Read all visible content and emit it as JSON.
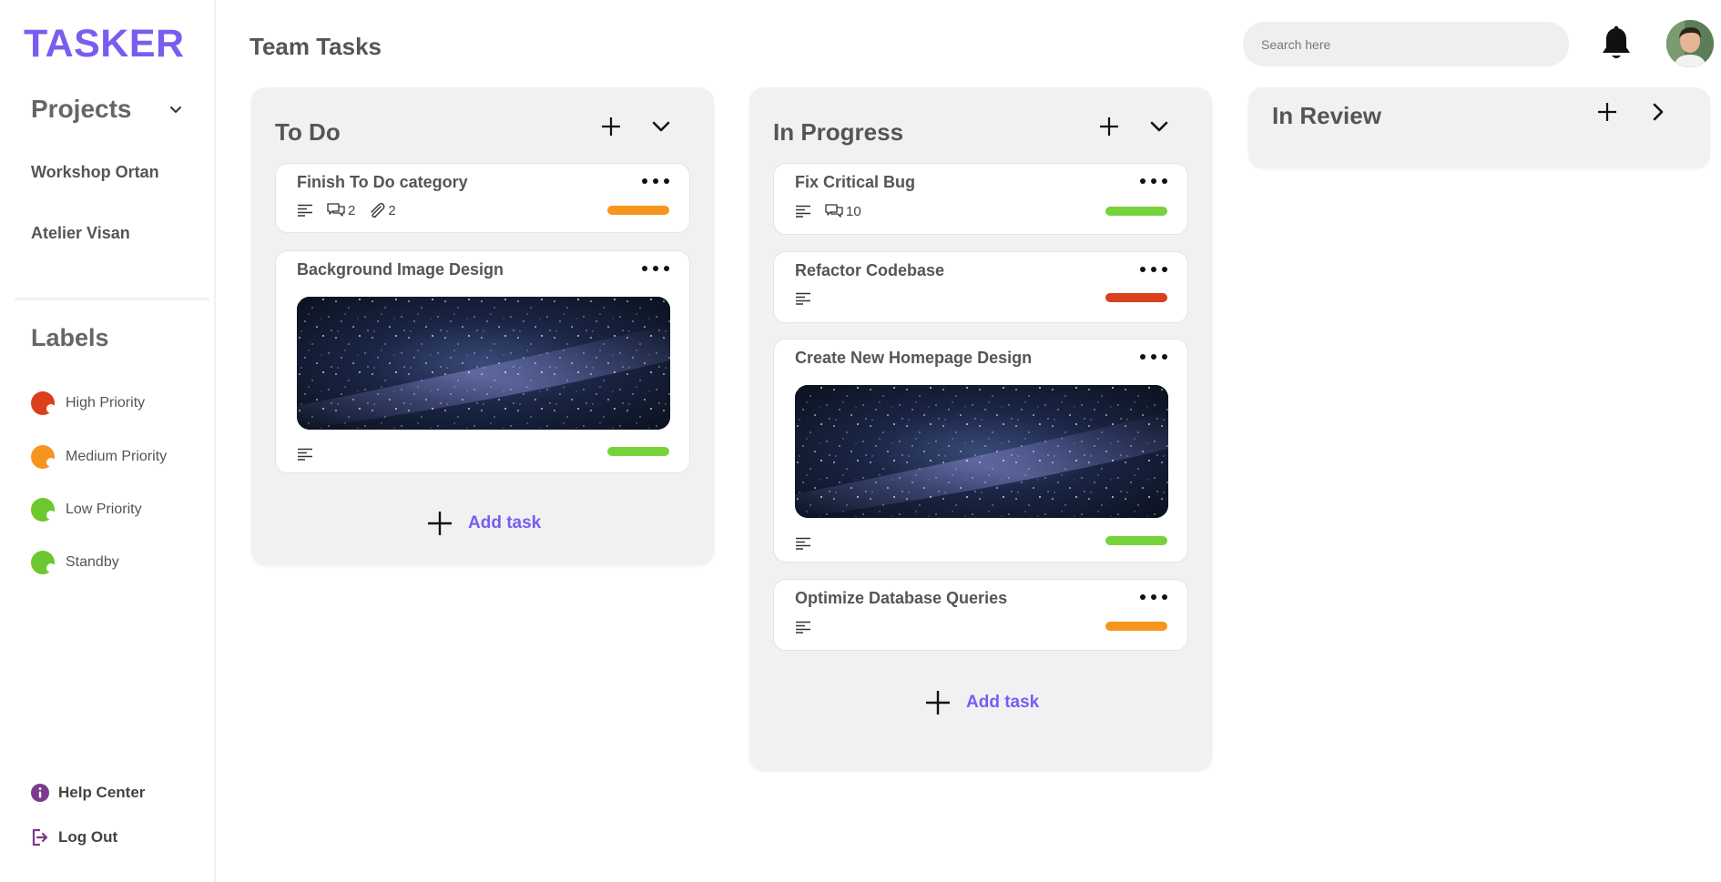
{
  "app": {
    "logo": "TASKER",
    "page_title": "Team Tasks"
  },
  "sidebar": {
    "projects_heading": "Projects",
    "projects": [
      "Workshop Ortan",
      "Atelier Visan"
    ],
    "labels_heading": "Labels",
    "labels": [
      {
        "name": "High Priority",
        "color": "#d9411e"
      },
      {
        "name": "Medium Priority",
        "color": "#f7941d"
      },
      {
        "name": "Low Priority",
        "color": "#6cc82e"
      },
      {
        "name": "Standby",
        "color": "#6cc82e"
      }
    ],
    "footer": {
      "help": "Help Center",
      "logout": "Log Out"
    }
  },
  "header": {
    "search_placeholder": "Search here",
    "icons": [
      "bell-icon",
      "user-avatar"
    ]
  },
  "colors": {
    "accent": "#7b5cf0",
    "green": "#77d23c",
    "orange": "#f7941d",
    "red": "#d9411e"
  },
  "columns": [
    {
      "title": "To Do",
      "add_task": "Add task",
      "cards": [
        {
          "title": "Finish To Do category",
          "comments": "2",
          "attachments": "2",
          "priority_color": "#f7941d"
        },
        {
          "title": "Background Image Design",
          "has_image": true,
          "priority_color": "#77d23c"
        }
      ]
    },
    {
      "title": "In Progress",
      "add_task": "Add task",
      "cards": [
        {
          "title": "Fix Critical Bug",
          "comments": "10",
          "priority_color": "#77d23c"
        },
        {
          "title": "Refactor Codebase",
          "priority_color": "#d9411e"
        },
        {
          "title": "Create New Homepage Design",
          "has_image": true,
          "priority_color": "#77d23c"
        },
        {
          "title": "Optimize Database Queries",
          "priority_color": "#f7941d"
        }
      ]
    },
    {
      "title": "In Review",
      "cards": []
    }
  ]
}
